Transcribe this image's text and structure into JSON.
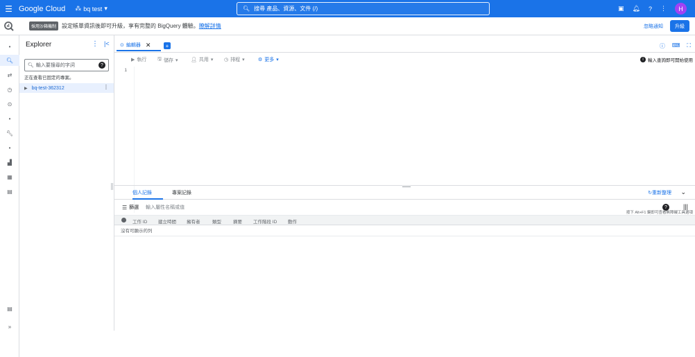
{
  "topbar": {
    "brand": "Google Cloud",
    "project": "bq test",
    "search_text": "搜尋  產品、資源、文件 (/)",
    "avatar_letter": "H"
  },
  "notice": {
    "badge": "採用沙箱機制",
    "message": "設定帳單資訊後即可升級，享有完整的 BigQuery 體驗。",
    "link": "瞭解詳情",
    "cancel": "忽略通知",
    "upgrade": "升級"
  },
  "explorer": {
    "title": "Explorer",
    "search_placeholder": "輸入要搜尋的字詞",
    "hint": "正在查看已固定的專案。",
    "project": "bq-test-362312"
  },
  "editor": {
    "tab_label": "編輯器",
    "toolbar": {
      "run": "執行",
      "save": "儲存",
      "share": "共用",
      "schedule": "排程",
      "more": "更多"
    },
    "info": "輸入查詢即可開始使用",
    "line_number": "1",
    "shortcut_hint": "按下 Alt+F1 鍵即可查看無障礙工具選項"
  },
  "results": {
    "tabs": [
      "個人記錄",
      "專案記錄"
    ],
    "refresh": "重新整理",
    "filter_label": "篩選",
    "filter_placeholder": "輸入屬性名稱或值",
    "columns": [
      "工作 ID",
      "建立時間",
      "擁有者",
      "類型",
      "摘要",
      "工作階段 ID",
      "動作"
    ],
    "empty": "沒有可顯示的列"
  }
}
